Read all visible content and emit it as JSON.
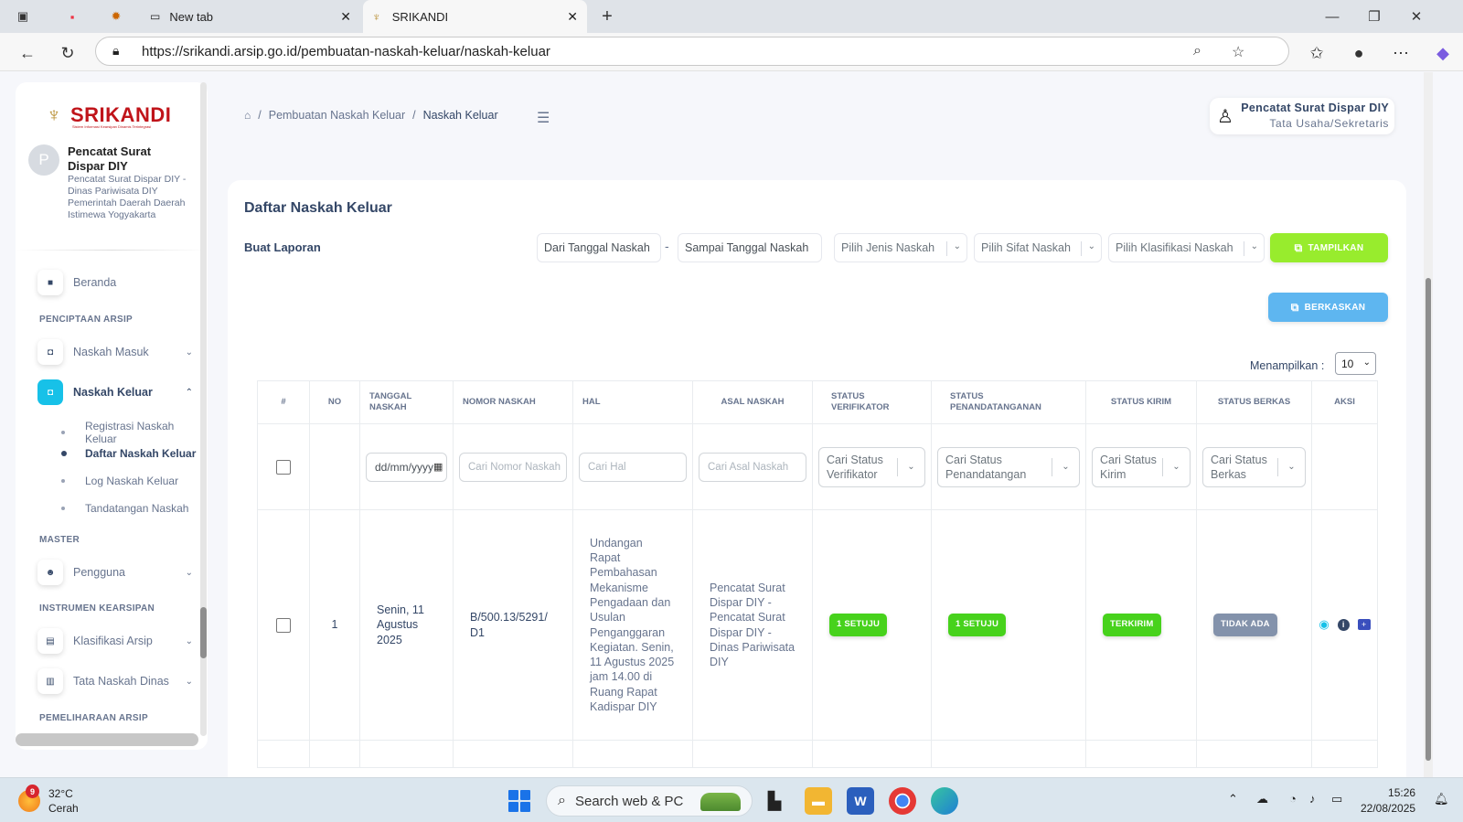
{
  "browser": {
    "tabs": [
      {
        "label": "New tab"
      },
      {
        "label": "SRIKANDI"
      }
    ],
    "url": "https://srikandi.arsip.go.id/pembuatan-naskah-keluar/naskah-keluar"
  },
  "sidebar": {
    "logo_text": "SRIKANDI",
    "logo_subtitle": "Sistem Informasi Kearsipan Dinamis Terintegrasi",
    "avatar_letter": "P",
    "user_name": "Pencatat Surat Dispar DIY",
    "user_desc": "Pencatat Surat Dispar DIY - Dinas Pariwisata DIY Pemerintah Daerah Daerah Istimewa Yogyakarta",
    "beranda": "Beranda",
    "sec_penciptaan": "PENCIPTAAN ARSIP",
    "naskah_masuk": "Naskah Masuk",
    "naskah_keluar": "Naskah Keluar",
    "sub": [
      "Registrasi Naskah Keluar",
      "Daftar Naskah Keluar",
      "Log Naskah Keluar",
      "Tandatangan Naskah"
    ],
    "sec_master": "MASTER",
    "pengguna": "Pengguna",
    "sec_instrumen": "INSTRUMEN KEARSIPAN",
    "klasifikasi": "Klasifikasi Arsip",
    "tata_naskah": "Tata Naskah Dinas",
    "sec_pemeliharaan": "PEMELIHARAAN ARSIP"
  },
  "breadcrumb": {
    "parent": "Pembuatan Naskah Keluar",
    "current": "Naskah Keluar"
  },
  "user": {
    "name": "Pencatat Surat Dispar DIY",
    "role": "Tata Usaha/Sekretaris"
  },
  "card": {
    "title": "Daftar Naskah Keluar",
    "report_label": "Buat Laporan",
    "from_date": "Dari Tanggal Naskah",
    "dash": "-",
    "to_date": "Sampai Tanggal Naskah",
    "jenis": "Pilih Jenis Naskah",
    "sifat": "Pilih Sifat Naskah",
    "klasifikasi": "Pilih Klasifikasi Naskah",
    "tampilkan": "TAMPILKAN",
    "berkaskan": "BERKASKAN",
    "showing_label": "Menampilkan :",
    "page_size": "10"
  },
  "table": {
    "headers": [
      "#",
      "NO",
      "TANGGAL NASKAH",
      "NOMOR NASKAH",
      "HAL",
      "ASAL NASKAH",
      "STATUS VERIFIKATOR",
      "STATUS PENANDATANGANAN",
      "STATUS KIRIM",
      "STATUS BERKAS",
      "AKSI"
    ],
    "filters": {
      "date_placeholder": "dd/mm/yyyy",
      "nomor": "Cari Nomor Naskah",
      "hal": "Cari Hal",
      "asal": "Cari Asal Naskah",
      "verifikator": "Cari Status Verifikator",
      "penandatangan": "Cari Status Penandatangan",
      "kirim": "Cari Status Kirim",
      "berkas": "Cari Status Berkas"
    },
    "rows": [
      {
        "no": "1",
        "tanggal": "Senin, 11 Agustus 2025",
        "nomor": "B/500.13/5291/ D1",
        "hal": "Undangan Rapat Pembahasan Mekanisme Pengadaan dan Usulan Penganggaran Kegiatan. Senin, 11 Agustus 2025 jam 14.00 di Ruang Rapat Kadispar DIY",
        "asal": "Pencatat Surat Dispar DIY - Pencatat Surat Dispar DIY - Dinas Pariwisata DIY",
        "verifikator": "1 SETUJU",
        "penandatangan": "1 SETUJU",
        "kirim": "TERKIRIM",
        "berkas": "TIDAK ADA"
      }
    ]
  },
  "taskbar": {
    "notif_count": "9",
    "temperature": "32°C",
    "weather": "Cerah",
    "search": "Search web & PC",
    "time": "15:26",
    "date": "22/08/2025"
  },
  "colors": {
    "accent": "#17c1e8",
    "green_button": "#98ec2d",
    "blue_button": "#5eb6f0",
    "success_badge": "#47d21c",
    "gray_badge": "#8392ab"
  }
}
